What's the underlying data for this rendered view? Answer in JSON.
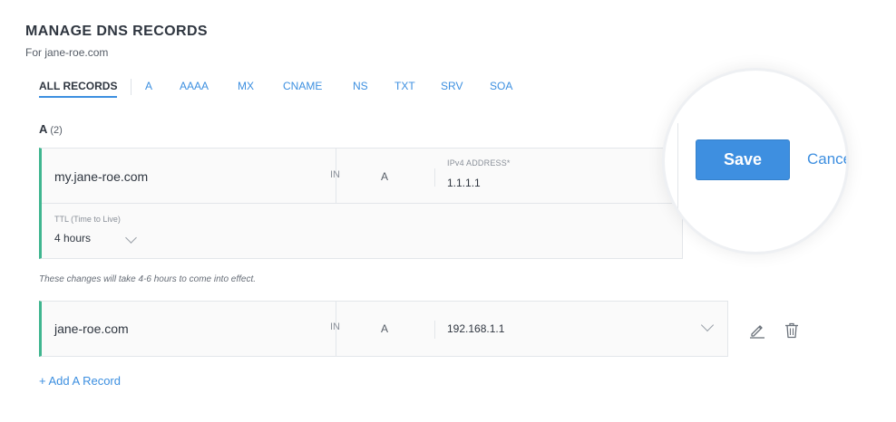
{
  "header": {
    "title": "MANAGE DNS RECORDS",
    "subtitle": "For jane-roe.com"
  },
  "tabs": [
    {
      "label": "ALL RECORDS",
      "active": true
    },
    {
      "label": "A"
    },
    {
      "label": "AAAA"
    },
    {
      "label": "MX"
    },
    {
      "label": "CNAME"
    },
    {
      "label": "NS"
    },
    {
      "label": "TXT"
    },
    {
      "label": "SRV"
    },
    {
      "label": "SOA"
    }
  ],
  "section": {
    "title": "A",
    "count": "(2)"
  },
  "edit_record": {
    "host": "my.jane-roe.com",
    "class": "IN",
    "type": "A",
    "address_label": "IPv4 ADDRESS*",
    "address_value": "1.1.1.1",
    "ttl_label": "TTL (Time to Live)",
    "ttl_value": "4 hours"
  },
  "note": "These changes will take 4-6 hours to come into effect.",
  "record": {
    "host": "jane-roe.com",
    "class": "IN",
    "type": "A",
    "address_value": "192.168.1.1"
  },
  "actions": {
    "save_label": "Save",
    "cancel_label": "Cance",
    "add_label": "+ Add A Record"
  },
  "icons": {
    "edit": "pencil-icon",
    "delete": "trash-icon",
    "expand": "chevron-down-icon"
  },
  "colors": {
    "accent": "#3e8fe0",
    "record_marker": "#3fb58f"
  }
}
